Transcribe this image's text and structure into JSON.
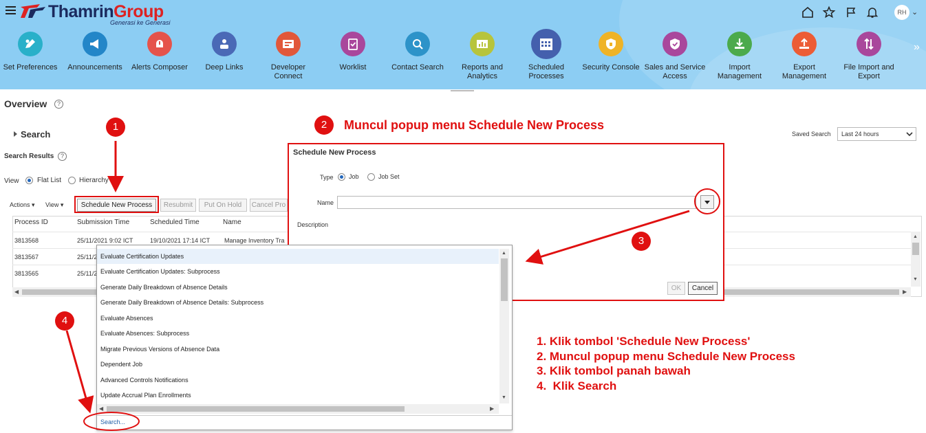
{
  "header": {
    "brand_name": "Thamrin",
    "brand_group": "Group",
    "tagline": "Generasi ke Generasi",
    "user_initials": "RH",
    "colors": {
      "background": "#8ccdf3",
      "brand_navy": "#1b2a5e",
      "brand_red": "#dd2222"
    }
  },
  "apps": [
    {
      "label": "Set Preferences",
      "icon": "preferences-icon",
      "color": "#29b0c9"
    },
    {
      "label": "Announcements",
      "icon": "megaphone-icon",
      "color": "#2386c8"
    },
    {
      "label": "Alerts Composer",
      "icon": "alert-icon",
      "color": "#e5534b"
    },
    {
      "label": "Deep Links",
      "icon": "links-icon",
      "color": "#4a69b6"
    },
    {
      "label": "Developer Connect",
      "icon": "developer-icon",
      "color": "#e1573a"
    },
    {
      "label": "Worklist",
      "icon": "worklist-icon",
      "color": "#a9479c"
    },
    {
      "label": "Contact Search",
      "icon": "contact-search-icon",
      "color": "#2d93c9"
    },
    {
      "label": "Reports and Analytics",
      "icon": "reports-icon",
      "color": "#b7c43c"
    },
    {
      "label": "Scheduled Processes",
      "icon": "calendar-icon",
      "color": "#4460ad"
    },
    {
      "label": "Security Console",
      "icon": "security-icon",
      "color": "#efb327"
    },
    {
      "label": "Sales and Service Access",
      "icon": "shield-icon",
      "color": "#a9479c"
    },
    {
      "label": "Import Management",
      "icon": "import-icon",
      "color": "#4caa4c"
    },
    {
      "label": "Export Management",
      "icon": "export-icon",
      "color": "#ec5c35"
    },
    {
      "label": "File Import and Export",
      "icon": "transfer-icon",
      "color": "#a9479c"
    }
  ],
  "page": {
    "title": "Overview",
    "search_label": "Search",
    "search_results_label": "Search Results",
    "view_label": "View",
    "flat_list": "Flat List",
    "hierarchy": "Hierarchy",
    "saved_search_label": "Saved Search",
    "saved_search_value": "Last 24 hours"
  },
  "toolbar": {
    "actions": "Actions",
    "view": "View",
    "schedule_new_process": "Schedule New Process",
    "resubmit": "Resubmit",
    "put_on_hold": "Put On Hold",
    "cancel_process": "Cancel Pro"
  },
  "table": {
    "columns": [
      "Process ID",
      "Submission Time",
      "Scheduled Time",
      "Name"
    ],
    "rows": [
      {
        "id": "3813568",
        "submitted": "25/11/2021 9:02 ICT",
        "scheduled": "19/10/2021 17:14 ICT",
        "name": "Manage Inventory Tra"
      },
      {
        "id": "3813567",
        "submitted": "25/11/2",
        "scheduled": "",
        "name": ""
      },
      {
        "id": "3813565",
        "submitted": "25/11/2",
        "scheduled": "",
        "name": ""
      }
    ]
  },
  "dialog": {
    "title": "Schedule New Process",
    "type_label": "Type",
    "type_job": "Job",
    "type_job_set": "Job Set",
    "name_label": "Name",
    "name_value": "",
    "description_label": "Description",
    "ok": "OK",
    "cancel": "Cancel"
  },
  "dropdown": {
    "items": [
      "Evaluate Certification Updates",
      "Evaluate Certification Updates: Subprocess",
      "Generate Daily Breakdown of Absence Details",
      "Generate Daily Breakdown of Absence Details: Subprocess",
      "Evaluate Absences",
      "Evaluate Absences: Subprocess",
      "Migrate Previous Versions of Absence Data",
      "Dependent Job",
      "Advanced Controls Notifications",
      "Update Accrual Plan Enrollments"
    ],
    "search_link": "Search..."
  },
  "annotations": {
    "badges": [
      "1",
      "2",
      "3",
      "4"
    ],
    "popup_note": "Muncul popup menu Schedule New Process",
    "steps": [
      "1. Klik tombol 'Schedule New Process'",
      "2. Muncul popup menu Schedule New Process",
      "3. Klik tombol panah bawah",
      "4.  Klik Search"
    ],
    "color": "#e01010"
  }
}
